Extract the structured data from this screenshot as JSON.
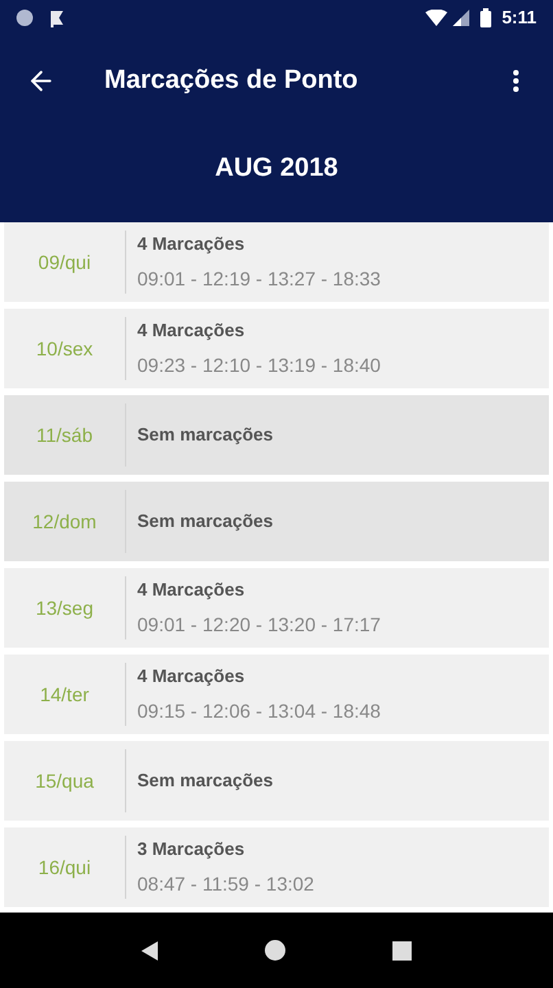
{
  "status_bar": {
    "time": "5:11"
  },
  "toolbar": {
    "title": "Marcações de Ponto"
  },
  "month": "AUG 2018",
  "days": [
    {
      "date": "09/qui",
      "weekend": false,
      "kind": "marks",
      "count": "4 Marcações",
      "times": "09:01 - 12:19 - 13:27 - 18:33"
    },
    {
      "date": "10/sex",
      "weekend": false,
      "kind": "marks",
      "count": "4 Marcações",
      "times": "09:23 - 12:10 - 13:19 - 18:40"
    },
    {
      "date": "11/sáb",
      "weekend": true,
      "kind": "empty",
      "message": "Sem marcações"
    },
    {
      "date": "12/dom",
      "weekend": true,
      "kind": "empty",
      "message": "Sem marcações"
    },
    {
      "date": "13/seg",
      "weekend": false,
      "kind": "marks",
      "count": "4 Marcações",
      "times": "09:01 - 12:20 - 13:20 - 17:17"
    },
    {
      "date": "14/ter",
      "weekend": false,
      "kind": "marks",
      "count": "4 Marcações",
      "times": "09:15 - 12:06 - 13:04 - 18:48"
    },
    {
      "date": "15/qua",
      "weekend": false,
      "kind": "empty",
      "message": "Sem marcações"
    },
    {
      "date": "16/qui",
      "weekend": false,
      "kind": "marks",
      "count": "3 Marcações",
      "times": "08:47 - 11:59 - 13:02"
    }
  ]
}
